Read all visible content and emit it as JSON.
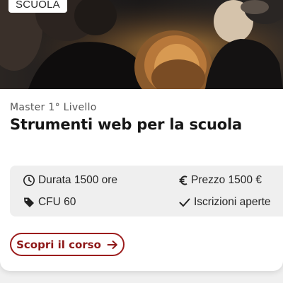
{
  "card": {
    "category": "SCUOLA",
    "eyebrow": "Master 1° Livello",
    "title": "Strumenti web per la scuola",
    "info": {
      "duration": {
        "icon": "clock-icon",
        "text": "Durata 1500 ore"
      },
      "price": {
        "icon": "euro-icon",
        "text": "Prezzo 1500 €"
      },
      "credits": {
        "icon": "tag-icon",
        "text": "CFU 60"
      },
      "enrollment": {
        "icon": "check-icon",
        "text": "Iscrizioni aperte"
      }
    },
    "cta": {
      "label": "Scopri il corso",
      "icon": "arrow-right-icon"
    }
  },
  "colors": {
    "accent": "#9c1c1c",
    "info_box_bg": "#efefef",
    "title_text": "#161616"
  }
}
